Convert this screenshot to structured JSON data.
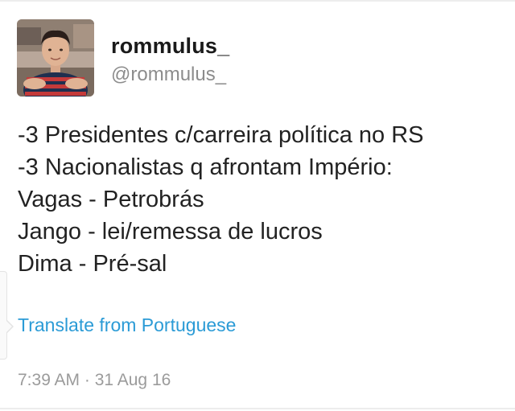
{
  "author": {
    "display_name": "rommulus_",
    "handle": "@rommulus_"
  },
  "tweet": {
    "lines": [
      "-3 Presidentes c/carreira política no RS",
      "-3 Nacionalistas q afrontam Império:",
      "Vagas - Petrobrás",
      "Jango - lei/remessa de lucros",
      "Dima - Pré-sal"
    ],
    "translate_label": "Translate from Portuguese",
    "timestamp": "7:39 AM · 31 Aug 16"
  },
  "colors": {
    "link": "#2b9bd6",
    "muted": "#8c8c8c",
    "text": "#222222"
  },
  "icons": {
    "avatar": "profile-photo"
  }
}
